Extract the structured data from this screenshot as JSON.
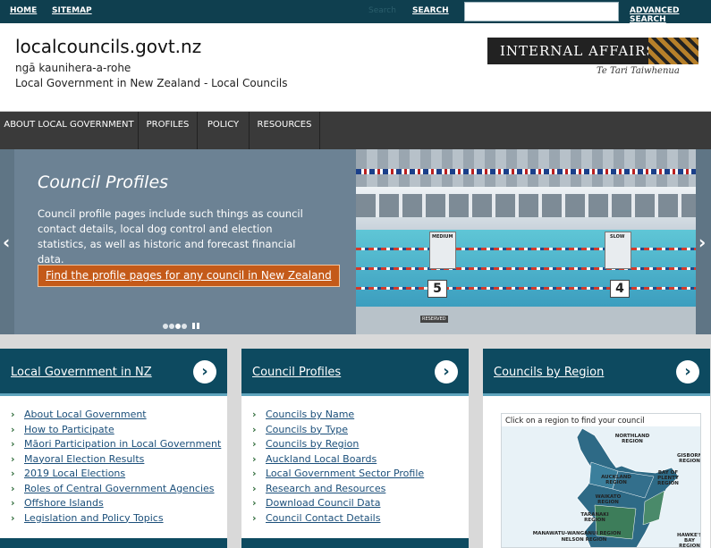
{
  "topbar": {
    "home": "HOME",
    "sitemap": "SITEMAP",
    "search_dim": "Search",
    "search": "SEARCH",
    "search_value": "",
    "advanced": "ADVANCED SEARCH"
  },
  "header": {
    "title": "localcouncils.govt.nz",
    "subtitle_maori": "ngā kaunihera-a-rohe",
    "subtitle": "Local Government in New Zealand - Local Councils",
    "logo_main": "INTERNAL AFFAIRS",
    "logo_maori": "Te Tari Taiwhenua"
  },
  "nav": [
    "ABOUT LOCAL GOVERNMENT",
    "PROFILES",
    "POLICY",
    "RESOURCES"
  ],
  "carousel": {
    "title": "Council Profiles",
    "text": "Council profile pages include such things as council contact details, local dog control and election statistics, as well as historic and forecast financial data.",
    "cta": "Find the profile pages for any council in New Zealand",
    "slide_count": 4,
    "active_slide": 2,
    "prev_icon": "chevron-left-icon",
    "next_icon": "chevron-right-icon",
    "image_labels": {
      "medium": "MEDIUM",
      "slow": "SLOW",
      "lane5": "5",
      "lane4": "4",
      "reserved": "RESERVED"
    }
  },
  "cards": [
    {
      "title": "Local Government in NZ",
      "links": [
        "About Local Government",
        "How to Participate",
        "Māori Participation in Local Government",
        "Mayoral Election Results",
        "2019 Local Elections",
        "Roles of Central Government Agencies",
        "Offshore Islands",
        "Legislation and Policy Topics"
      ]
    },
    {
      "title": "Council Profiles",
      "links": [
        "Councils by Name",
        "Councils by Type",
        "Councils by Region",
        "Auckland Local Boards",
        "Local Government Sector Profile",
        "Research and Resources",
        "Download Council Data",
        "Council Contact Details"
      ]
    },
    {
      "title": "Councils by Region",
      "map_caption": "Click on a region to find your council",
      "regions": [
        "NORTHLAND REGION",
        "GISBORNE REGION",
        "AUCKLAND REGION",
        "BAY OF PLENTY REGION",
        "WAIKATO REGION",
        "TARANAKI REGION",
        "MANAWATU-WANGANUI REGION",
        "NELSON REGION",
        "HAWKE'S BAY REGION"
      ]
    }
  ],
  "colors": {
    "topbar": "#0f3f4f",
    "nav": "#3a3a3a",
    "card_head": "#0d4a60",
    "cta": "#c45a19",
    "link": "#1b4f7a",
    "chevron": "#2f6b3a"
  }
}
